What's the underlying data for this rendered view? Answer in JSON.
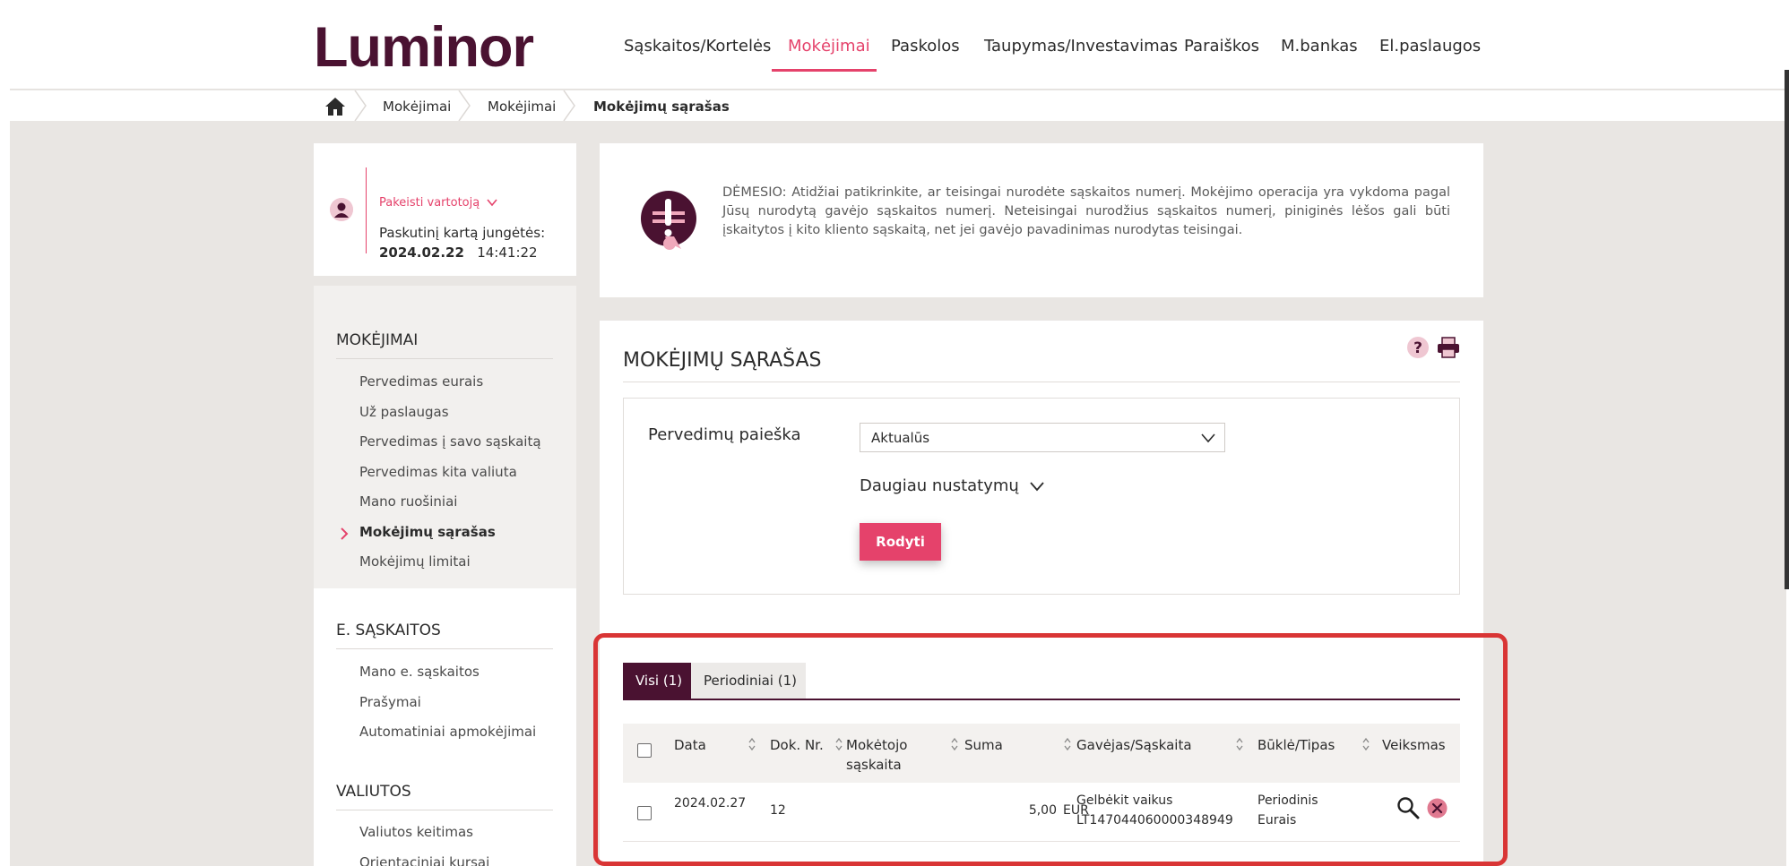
{
  "brand": {
    "logo_text": "Luminor",
    "accent": "#e5426b",
    "dark": "#4a1231"
  },
  "nav": {
    "items": [
      {
        "label": "Sąskaitos/Kortelės"
      },
      {
        "label": "Mokėjimai"
      },
      {
        "label": "Paskolos"
      },
      {
        "label": "Taupymas/Investavimas"
      },
      {
        "label": "Paraiškos"
      },
      {
        "label": "M.bankas"
      },
      {
        "label": "El.paslaugos"
      }
    ]
  },
  "breadcrumb": {
    "home_icon": "home-icon",
    "items": [
      {
        "label": "Mokėjimai"
      },
      {
        "label": "Mokėjimai"
      },
      {
        "label": "Mokėjimų sąrašas"
      }
    ]
  },
  "user": {
    "change_user": "Pakeisti vartotoją",
    "last_login_label": "Paskutinį kartą jungėtės:",
    "last_login_date": "2024.02.22",
    "last_login_time": "14:41:22"
  },
  "sidebar": {
    "sections": [
      {
        "title": "MOKĖJIMAI",
        "items": [
          {
            "label": "Pervedimas eurais"
          },
          {
            "label": "Už paslaugas"
          },
          {
            "label": "Pervedimas į savo sąskaitą"
          },
          {
            "label": "Pervedimas kita valiuta"
          },
          {
            "label": "Mano ruošiniai"
          },
          {
            "label": "Mokėjimų sąrašas"
          },
          {
            "label": "Mokėjimų limitai"
          }
        ]
      },
      {
        "title": "E. SĄSKAITOS",
        "items": [
          {
            "label": "Mano e. sąskaitos"
          },
          {
            "label": "Prašymai"
          },
          {
            "label": "Automatiniai apmokėjimai"
          }
        ]
      },
      {
        "title": "VALIUTOS",
        "items": [
          {
            "label": "Valiutos keitimas"
          },
          {
            "label": "Orientaciniai kursai"
          }
        ]
      }
    ]
  },
  "notice": {
    "text": "DĖMESIO: Atidžiai patikrinkite, ar teisingai nurodėte sąskaitos numerį. Mokėjimo operacija yra vykdoma pagal Jūsų nurodytą gavėjo sąskaitos numerį. Neteisingai nurodžius sąskaitos numerį, piniginės lėšos gali būti įskaitytos į kito kliento sąskaitą, net jei gavėjo pavadinimas nurodytas teisingai."
  },
  "main": {
    "title": "MOKĖJIMŲ SĄRAŠAS",
    "search_label": "Pervedimų paieška",
    "search_select_value": "Aktualūs",
    "more_settings": "Daugiau nustatymų",
    "show_button": "Rodyti",
    "tabs": [
      {
        "label": "Visi (1)"
      },
      {
        "label": "Periodiniai (1)"
      }
    ],
    "columns": {
      "date": "Data",
      "doc_no": "Dok. Nr.",
      "payer_account_1": "Mokėtojo",
      "payer_account_2": "sąskaita",
      "amount": "Suma",
      "recipient": "Gavėjas/Sąskaita",
      "status": "Būklė/Tipas",
      "actions": "Veiksmas"
    },
    "rows": [
      {
        "date": "2024.02.27",
        "doc_no": "12",
        "payer_account": "",
        "amount": "5,00",
        "currency": "EUR",
        "recipient_name": "Gelbėkit vaikus",
        "recipient_account": "LT147044060000348949",
        "status": "Periodinis",
        "type": "Eurais"
      }
    ]
  }
}
